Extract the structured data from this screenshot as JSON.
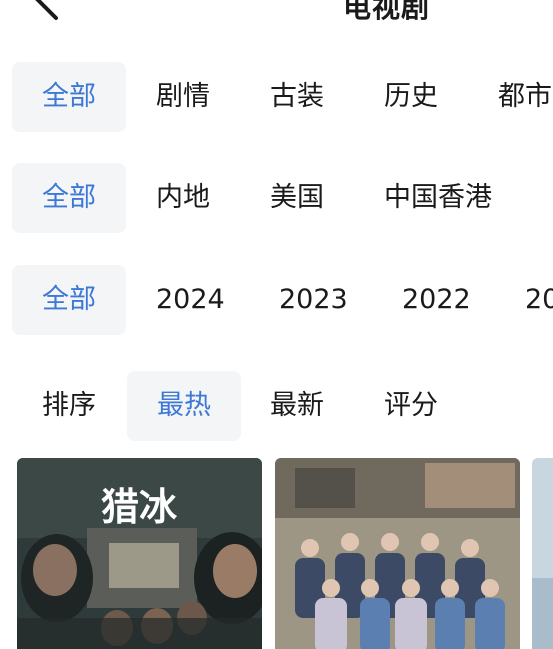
{
  "header": {
    "title": "电视剧",
    "back_icon": "chevron-left-icon"
  },
  "filters": {
    "genre": [
      "全部",
      "剧情",
      "古装",
      "历史",
      "都市"
    ],
    "region": [
      "全部",
      "内地",
      "美国",
      "中国香港"
    ],
    "year": [
      "全部",
      "2024",
      "2023",
      "2022",
      "20"
    ]
  },
  "sort": {
    "label": "排序",
    "options": [
      "最热",
      "最新",
      "评分"
    ],
    "selected": "最热"
  },
  "posters": [
    {
      "title_text": "猎冰"
    }
  ],
  "colors": {
    "accent": "#3d78d8",
    "chip_bg": "#f4f5f7",
    "text": "#1a1a1a"
  }
}
